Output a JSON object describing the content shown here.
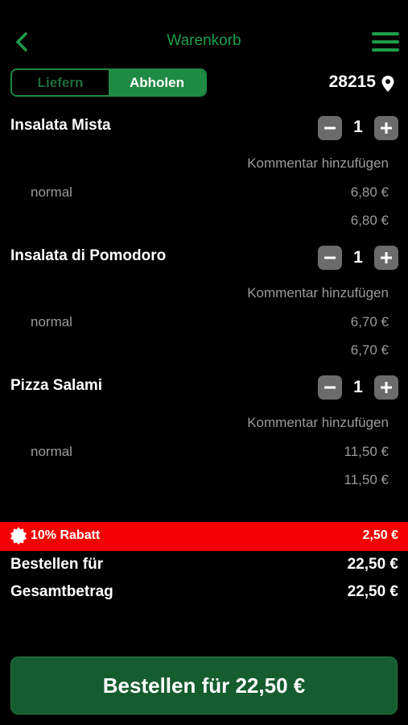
{
  "header": {
    "title": "Warenkorb",
    "back_icon": "chevron-left-icon",
    "menu_icon": "hamburger-menu-icon"
  },
  "mode": {
    "options": [
      "Liefern",
      "Abholen"
    ],
    "selected": "Abholen"
  },
  "location": {
    "zip": "28215",
    "icon": "map-pin-icon"
  },
  "items": [
    {
      "name": "Insalata Mista",
      "qty": "1",
      "comment": "Kommentar hinzufügen",
      "variant": "normal",
      "variant_price": "6,80 €",
      "total": "6,80 €"
    },
    {
      "name": "Insalata di Pomodoro",
      "qty": "1",
      "comment": "Kommentar hinzufügen",
      "variant": "normal",
      "variant_price": "6,70 €",
      "total": "6,70 €"
    },
    {
      "name": "Pizza Salami",
      "qty": "1",
      "comment": "Kommentar hinzufügen",
      "variant": "normal",
      "variant_price": "11,50 €",
      "total": "11,50 €"
    }
  ],
  "discount": {
    "label": "10% Rabatt",
    "value": "2,50 €",
    "color": "#f50000"
  },
  "summary": {
    "order_for_label": "Bestellen für",
    "order_for_value": "22,50 €",
    "total_label": "Gesamtbetrag",
    "total_value": "22,50 €"
  },
  "order_button": {
    "label": "Bestellen für 22,50 €"
  },
  "colors": {
    "accent": "#1f9d4a",
    "button_bg": "#155c2e"
  }
}
